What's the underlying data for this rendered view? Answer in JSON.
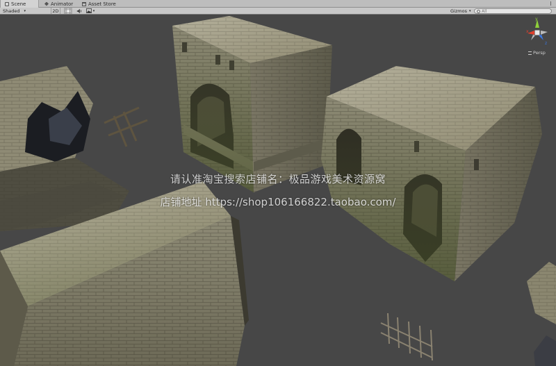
{
  "tabs": [
    {
      "label": "Scene",
      "icon": "scene-icon"
    },
    {
      "label": "Animator",
      "icon": "animator-icon"
    },
    {
      "label": "Asset Store",
      "icon": "asset-store-icon"
    }
  ],
  "toolbar": {
    "shading_mode": "Shaded",
    "mode_2d": "2D",
    "lighting_icon": "sun-icon",
    "audio_icon": "speaker-icon",
    "effects_icon": "image-icon",
    "gizmos_label": "Gizmos",
    "search_placeholder": "All"
  },
  "viewport": {
    "projection": "Persp",
    "axes": {
      "x": "x",
      "y": "y",
      "z": "z"
    },
    "background_color": "#474747"
  },
  "watermark": {
    "line1": "请认准淘宝搜索店铺名：极品游戏美术资源窝",
    "line2": "店铺地址 https://shop106166822.taobao.com/"
  },
  "colors": {
    "stone_light": "#a9a58f",
    "stone_dark": "#6d6a58",
    "moss": "#5e6a3c",
    "axis_x": "#e0402c",
    "axis_y": "#8fd03a",
    "axis_z": "#3a76e0"
  }
}
